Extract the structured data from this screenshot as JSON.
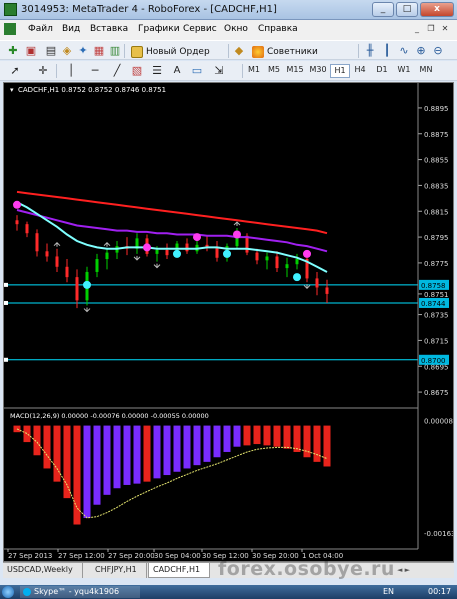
{
  "window": {
    "title": "3014953: MetaTrader 4 - RoboForex - [CADCHF,H1]",
    "min": "_",
    "max": "□",
    "close": "x"
  },
  "menu": [
    "Файл",
    "Вид",
    "Вставка",
    "Графики",
    "Сервис",
    "Окно",
    "Справка"
  ],
  "toolbar": {
    "new_order": "Новый Ордер",
    "advisors": "Советники"
  },
  "timeframes": [
    "M1",
    "M5",
    "M15",
    "M30",
    "H1",
    "H4",
    "D1",
    "W1",
    "MN"
  ],
  "active_timeframe": "H1",
  "chart": {
    "header": "CADCHF,H1  0.8752 0.8752 0.8746 0.8751",
    "price_labels": [
      "0.8895",
      "0.8875",
      "0.8855",
      "0.8835",
      "0.8815",
      "0.8795",
      "0.8775",
      "0.8751",
      "0.8735",
      "0.8715",
      "0.8695",
      "0.8675"
    ],
    "hline_labels": [
      "0.8758",
      "0.8744",
      "0.8700"
    ],
    "macd_header": "MACD(12,26,9) 0.00000 -0.00076 0.00000 -0.00055 0.00000",
    "macd_labels": [
      "0.00008",
      "-0.00163"
    ],
    "time_labels": [
      "27 Sep 2013",
      "27 Sep 12:00",
      "27 Sep 20:00",
      "30 Sep 04:00",
      "30 Sep 12:00",
      "30 Sep 20:00",
      "1 Oct 04:00"
    ],
    "colors": {
      "bull": "#00d000",
      "bear": "#ff2a2a",
      "ma_red": "#ff2020",
      "ma_purple": "#a020f0",
      "ma_cyan": "#7fffff",
      "dot_magenta": "#ff3cf0",
      "dot_cyan": "#40f0ff",
      "macd_red": "#e8241c",
      "macd_purple": "#7a2cff",
      "hline": "#00e0ff"
    }
  },
  "chart_data": {
    "type": "candlestick",
    "symbol": "CADCHF",
    "timeframe": "H1",
    "ohlc": [
      [
        0.8808,
        0.8812,
        0.88,
        0.8805
      ],
      [
        0.8805,
        0.8807,
        0.8795,
        0.8798
      ],
      [
        0.8798,
        0.8801,
        0.878,
        0.8784
      ],
      [
        0.8784,
        0.879,
        0.8776,
        0.878
      ],
      [
        0.878,
        0.8786,
        0.8768,
        0.8772
      ],
      [
        0.8772,
        0.8778,
        0.876,
        0.8764
      ],
      [
        0.8764,
        0.877,
        0.874,
        0.8746
      ],
      [
        0.8746,
        0.8772,
        0.8742,
        0.8768
      ],
      [
        0.8768,
        0.8782,
        0.8764,
        0.8778
      ],
      [
        0.8778,
        0.8786,
        0.877,
        0.8783
      ],
      [
        0.8783,
        0.8792,
        0.8778,
        0.8788
      ],
      [
        0.8788,
        0.8795,
        0.8781,
        0.8786
      ],
      [
        0.8786,
        0.8798,
        0.8782,
        0.8794
      ],
      [
        0.8794,
        0.8797,
        0.878,
        0.8782
      ],
      [
        0.8782,
        0.8788,
        0.8776,
        0.8785
      ],
      [
        0.8785,
        0.879,
        0.8778,
        0.8781
      ],
      [
        0.8781,
        0.8792,
        0.8779,
        0.879
      ],
      [
        0.879,
        0.8794,
        0.8782,
        0.8784
      ],
      [
        0.8784,
        0.8792,
        0.8782,
        0.8789
      ],
      [
        0.8789,
        0.8796,
        0.8784,
        0.8787
      ],
      [
        0.8787,
        0.8792,
        0.8776,
        0.8779
      ],
      [
        0.8779,
        0.879,
        0.8776,
        0.8788
      ],
      [
        0.8788,
        0.8802,
        0.8786,
        0.8796
      ],
      [
        0.8796,
        0.8798,
        0.8781,
        0.8783
      ],
      [
        0.8783,
        0.8786,
        0.8774,
        0.8777
      ],
      [
        0.8777,
        0.8783,
        0.877,
        0.878
      ],
      [
        0.878,
        0.8784,
        0.8768,
        0.8771
      ],
      [
        0.8771,
        0.8779,
        0.8764,
        0.8774
      ],
      [
        0.8774,
        0.8782,
        0.877,
        0.8778
      ],
      [
        0.8778,
        0.878,
        0.876,
        0.8763
      ],
      [
        0.8763,
        0.8768,
        0.875,
        0.8756
      ],
      [
        0.8756,
        0.8762,
        0.8744,
        0.8751
      ]
    ],
    "ma_red": [
      0.883,
      0.8829,
      0.8828,
      0.8827,
      0.8826,
      0.8825,
      0.8824,
      0.8823,
      0.8822,
      0.8821,
      0.882,
      0.8819,
      0.8818,
      0.8817,
      0.8816,
      0.8815,
      0.8814,
      0.8813,
      0.8812,
      0.8811,
      0.881,
      0.8809,
      0.8808,
      0.8807,
      0.8806,
      0.8805,
      0.8804,
      0.8803,
      0.8802,
      0.8801,
      0.88,
      0.8798
    ],
    "ma_purple": [
      0.8816,
      0.8814,
      0.8812,
      0.881,
      0.8808,
      0.8806,
      0.8804,
      0.8803,
      0.8802,
      0.8801,
      0.88,
      0.88,
      0.8799,
      0.8799,
      0.8798,
      0.8798,
      0.8797,
      0.8797,
      0.8797,
      0.8796,
      0.8796,
      0.8796,
      0.8795,
      0.8795,
      0.8794,
      0.8793,
      0.8792,
      0.8791,
      0.8789,
      0.8788,
      0.8786,
      0.8784
    ],
    "ma_cyan": [
      0.8822,
      0.8818,
      0.8813,
      0.8808,
      0.8803,
      0.8797,
      0.8792,
      0.8789,
      0.8787,
      0.8786,
      0.8786,
      0.8787,
      0.8787,
      0.8787,
      0.8786,
      0.8786,
      0.8786,
      0.8786,
      0.8786,
      0.8787,
      0.8787,
      0.8786,
      0.8786,
      0.8786,
      0.8785,
      0.8784,
      0.8783,
      0.8781,
      0.8779,
      0.8776,
      0.8772,
      0.8768
    ],
    "dots_magenta": [
      [
        0,
        0.882
      ],
      [
        13,
        0.8787
      ],
      [
        18,
        0.8795
      ],
      [
        22,
        0.8797
      ],
      [
        29,
        0.8782
      ]
    ],
    "dots_cyan": [
      [
        7,
        0.8758
      ],
      [
        16,
        0.8782
      ],
      [
        21,
        0.8782
      ],
      [
        28,
        0.8764
      ]
    ],
    "fractal_up": [
      4,
      9,
      22
    ],
    "fractal_down": [
      7,
      12,
      14,
      29
    ],
    "macd": [
      -0.0001,
      -0.00025,
      -0.00045,
      -0.00065,
      -0.00085,
      -0.0011,
      -0.0015,
      -0.0014,
      -0.0012,
      -0.00105,
      -0.00095,
      -0.0009,
      -0.00088,
      -0.00085,
      -0.0008,
      -0.00075,
      -0.0007,
      -0.00065,
      -0.0006,
      -0.00055,
      -0.00048,
      -0.0004,
      -0.00032,
      -0.0003,
      -0.00028,
      -0.0003,
      -0.00032,
      -0.00035,
      -0.0004,
      -0.00048,
      -0.00055,
      -0.00062
    ],
    "macd_signal": [
      -5e-05,
      -0.00012,
      -0.00025,
      -0.00045,
      -0.00065,
      -0.0009,
      -0.00125,
      -0.0014,
      -0.00138,
      -0.00132,
      -0.00124,
      -0.00115,
      -0.00107,
      -0.001,
      -0.00093,
      -0.00087,
      -0.0008,
      -0.00074,
      -0.00068,
      -0.00063,
      -0.00058,
      -0.00052,
      -0.00046,
      -0.0004,
      -0.00036,
      -0.00034,
      -0.00033,
      -0.00033,
      -0.00035,
      -0.00039,
      -0.00044,
      -0.0005
    ],
    "macd_color": [
      "r",
      "r",
      "r",
      "r",
      "r",
      "r",
      "r",
      "p",
      "p",
      "p",
      "p",
      "p",
      "p",
      "r",
      "p",
      "p",
      "p",
      "p",
      "p",
      "p",
      "p",
      "p",
      "p",
      "r",
      "r",
      "r",
      "r",
      "r",
      "r",
      "r",
      "r",
      "r"
    ],
    "price_range": [
      0.8665,
      0.8905
    ],
    "macd_range": [
      -0.00175,
      0.0001
    ]
  },
  "tabs": [
    "USDCAD,Weekly",
    "CHFJPY,H1",
    "CADCHF,H1"
  ],
  "active_tab": "CADCHF,H1",
  "watermark": "forex.osobye.ru",
  "taskbar": {
    "app": "Skype™ - yqu4k1906",
    "lang": "EN",
    "clock": "00:17"
  }
}
